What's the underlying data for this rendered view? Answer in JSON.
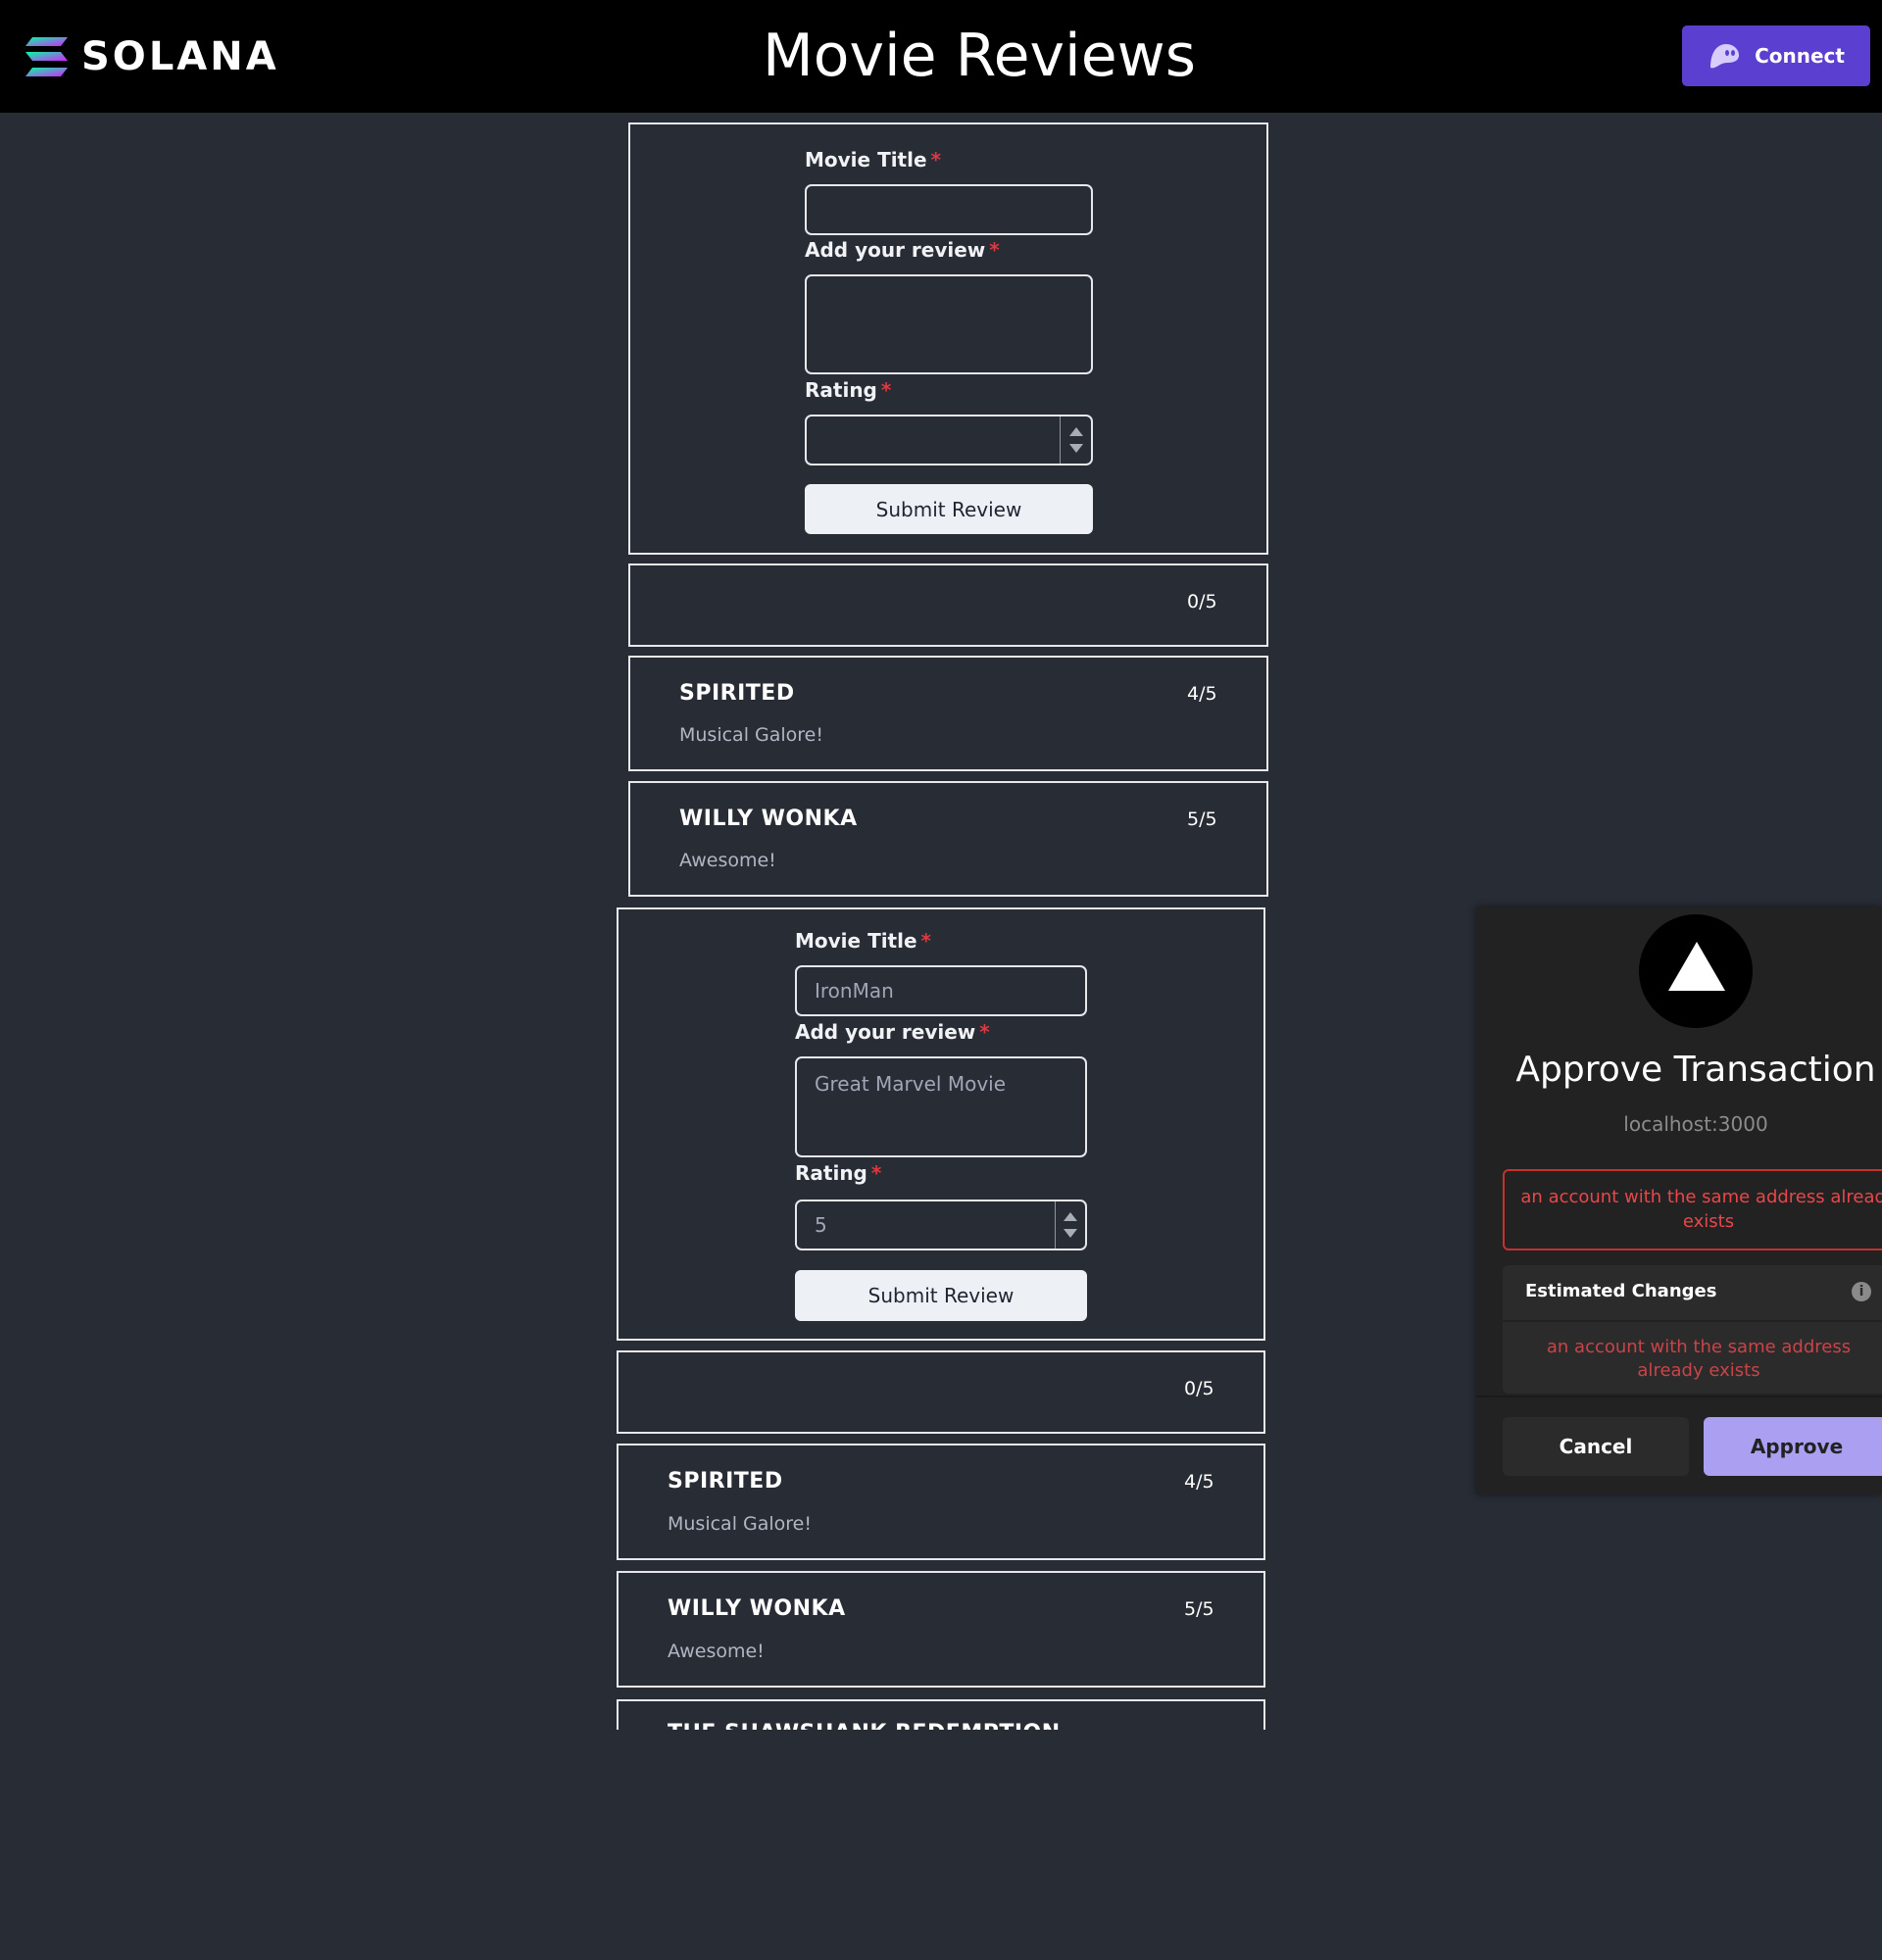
{
  "header": {
    "logo_text": "SOLANA",
    "title": "Movie Reviews",
    "connect_label": "Connect"
  },
  "form_top": {
    "title_label": "Movie Title",
    "title_value": "",
    "review_label": "Add your review",
    "review_value": "",
    "rating_label": "Rating",
    "rating_value": "",
    "required_marker": "*",
    "submit_label": "Submit Review"
  },
  "reviews_top": [
    {
      "title": "",
      "description": "",
      "rating": "0/5"
    },
    {
      "title": "SPIRITED",
      "description": "Musical Galore!",
      "rating": "4/5"
    },
    {
      "title": "WILLY WONKA",
      "description": "Awesome!",
      "rating": "5/5"
    }
  ],
  "form_bottom": {
    "title_label": "Movie Title",
    "title_value": "IronMan",
    "review_label": "Add your review",
    "review_value": "Great Marvel Movie",
    "rating_label": "Rating",
    "rating_value": "5",
    "required_marker": "*",
    "submit_label": "Submit Review"
  },
  "reviews_bottom": [
    {
      "title": "",
      "description": "",
      "rating": "0/5"
    },
    {
      "title": "SPIRITED",
      "description": "Musical Galore!",
      "rating": "4/5"
    },
    {
      "title": "WILLY WONKA",
      "description": "Awesome!",
      "rating": "5/5"
    }
  ],
  "clipped_review_title": "THE SHAWSHANK REDEMPTION",
  "wallet": {
    "title": "Approve Transaction",
    "origin": "localhost:3000",
    "error": "an account with the same address already exists",
    "estimated_title": "Estimated Changes",
    "estimated_info_icon": "i",
    "estimated_error": "an account with the same address already exists",
    "cancel_label": "Cancel",
    "approve_label": "Approve",
    "accent_color": "#ab9ff2",
    "error_color": "#e8474a"
  },
  "colors": {
    "background": "#282c35",
    "topbar": "#000000",
    "connect_button": "#5b3fd0",
    "required_marker": "#e0383e"
  },
  "icons": {
    "logo": "solana-logo-icon",
    "connect": "phantom-ghost-icon",
    "wallet_logo": "triangle-logo-icon",
    "info": "info-icon",
    "spin_up": "chevron-up-icon",
    "spin_down": "chevron-down-icon"
  }
}
